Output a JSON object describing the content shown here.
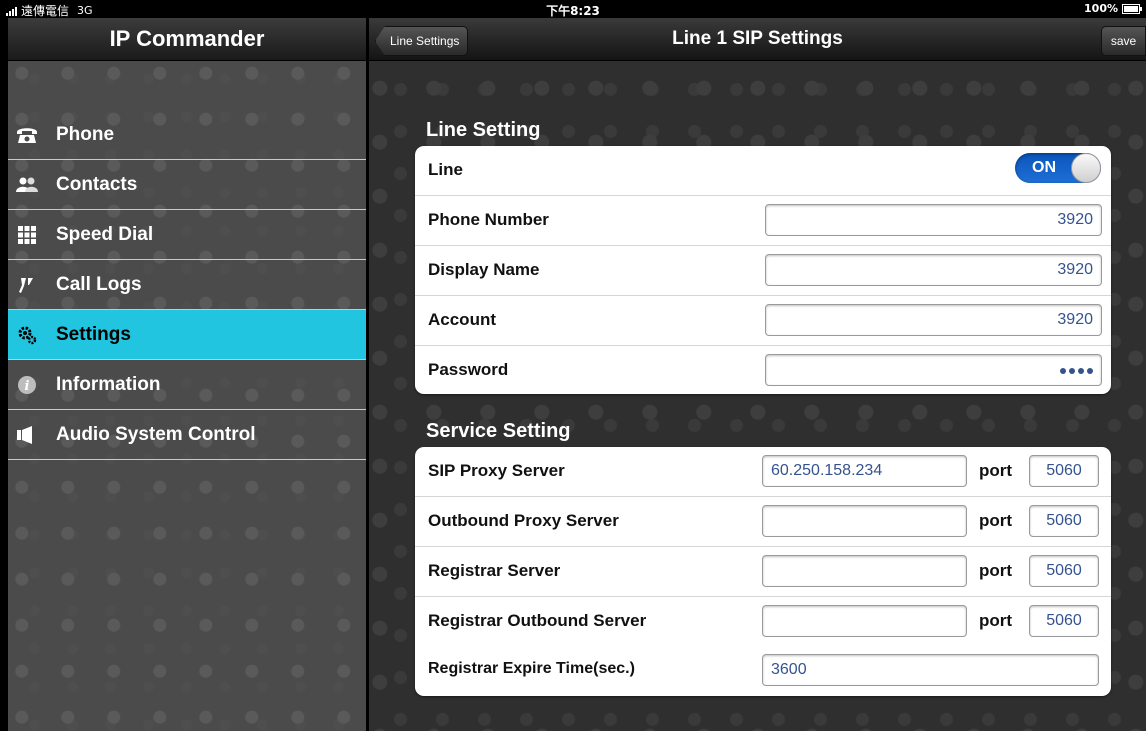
{
  "status_bar": {
    "carrier": "遠傳電信",
    "network": "3G",
    "time": "下午8:23",
    "battery": "100%",
    "battery_level": 1.0
  },
  "master": {
    "title": "IP Commander",
    "items": [
      {
        "label": "Phone",
        "icon": "telephone-icon",
        "selected": false
      },
      {
        "label": "Contacts",
        "icon": "contacts-icon",
        "selected": false
      },
      {
        "label": "Speed Dial",
        "icon": "keypad-grid-icon",
        "selected": false
      },
      {
        "label": "Call Logs",
        "icon": "call-logs-icon",
        "selected": false
      },
      {
        "label": "Settings",
        "icon": "gears-icon",
        "selected": true
      },
      {
        "label": "Information",
        "icon": "info-icon",
        "selected": false
      },
      {
        "label": "Audio System Control",
        "icon": "speaker-icon",
        "selected": false
      }
    ],
    "selected_color": "#22c5df"
  },
  "detail": {
    "back_label": "Line Settings",
    "title": "Line 1 SIP Settings",
    "save_label": "save",
    "line_section": {
      "title": "Line Setting",
      "line_label": "Line",
      "line_toggle": "ON",
      "rows": [
        {
          "label": "Phone Number",
          "value": "3920"
        },
        {
          "label": "Display Name",
          "value": "3920"
        },
        {
          "label": "Account",
          "value": "3920"
        },
        {
          "label": "Password",
          "value": "••••"
        }
      ]
    },
    "service_section": {
      "title": "Service Setting",
      "port_label": "port",
      "rows": [
        {
          "label": "SIP Proxy Server",
          "value": "60.250.158.234",
          "port": "5060"
        },
        {
          "label": "Outbound Proxy Server",
          "value": "",
          "port": "5060"
        },
        {
          "label": "Registrar Server",
          "value": "",
          "port": "5060"
        },
        {
          "label": "Registrar Outbound Server",
          "value": "",
          "port": "5060"
        }
      ],
      "expire_label": "Registrar Expire Time(sec.)",
      "expire_value": "3600"
    },
    "accent_toggle_color": "#1f6fd6"
  }
}
